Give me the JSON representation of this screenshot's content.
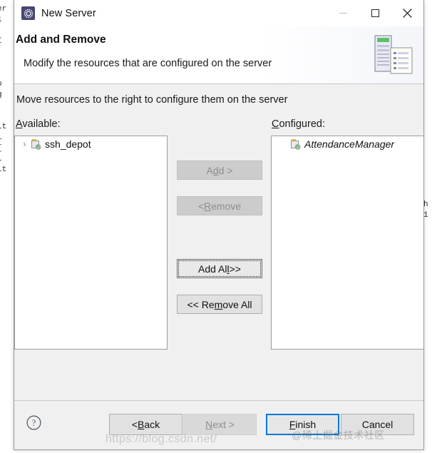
{
  "window": {
    "title": "New Server",
    "icon": "server-gear-icon",
    "controls": {
      "minimize": "minimize-icon",
      "maximize": "maximize-icon",
      "close": "close-icon"
    }
  },
  "header": {
    "title": "Add and Remove",
    "description": "Modify the resources that are configured on the server",
    "artwork": "server-and-document-icon"
  },
  "body": {
    "instruction": "Move resources to the right to configure them on the server",
    "available": {
      "label_prefix": "",
      "label_mnemonic": "A",
      "label_suffix": "vailable:",
      "items": [
        {
          "name": "ssh_depot",
          "icon": "project-icon",
          "expandable": true,
          "expander": "›",
          "italic": false
        }
      ]
    },
    "configured": {
      "label_prefix": "",
      "label_mnemonic": "C",
      "label_suffix": "onfigured:",
      "items": [
        {
          "name": "AttendanceManager",
          "icon": "project-icon",
          "expandable": false,
          "expander": "",
          "italic": true
        }
      ]
    },
    "transfer_buttons": [
      {
        "prefix": "A",
        "mnemonic": "d",
        "suffix": "d >",
        "state": "disabled",
        "key": "add"
      },
      {
        "prefix": "< ",
        "mnemonic": "R",
        "suffix": "emove",
        "state": "disabled",
        "key": "remove"
      },
      {
        "prefix": "Add Al",
        "mnemonic": "l",
        "suffix": " >>",
        "state": "focused",
        "key": "add-all"
      },
      {
        "prefix": "<< Re",
        "mnemonic": "m",
        "suffix": "ove All",
        "state": "enabled",
        "key": "remove-all"
      }
    ]
  },
  "footer": {
    "help": "help-icon",
    "buttons": [
      {
        "prefix": "< ",
        "mnemonic": "B",
        "suffix": "ack",
        "state": "enabled",
        "key": "back"
      },
      {
        "prefix": "",
        "mnemonic": "N",
        "suffix": "ext >",
        "state": "disabled",
        "key": "next"
      },
      {
        "prefix": "",
        "mnemonic": "F",
        "suffix": "inish",
        "state": "default",
        "key": "finish"
      },
      {
        "prefix": "Cancel",
        "mnemonic": "",
        "suffix": "",
        "state": "enabled",
        "key": "cancel"
      }
    ]
  },
  "watermarks": {
    "url": "https://blog.csdn.net/",
    "community": "@稀土掘金技术社区"
  },
  "background_code": {
    "left": "er\n1\n\nI\n\n\n\np\ng\n\n\nlt\ni\n{\ni\nlt\n\n\n|",
    "right": "h\n1"
  },
  "colors": {
    "accent": "#0078d7",
    "dialog_bg": "#f0f0f0",
    "titlebar_bg": "#ffffff",
    "title_icon_bg": "#464673",
    "border": "#9a9a9a",
    "disabled_text": "#8d8d8d"
  }
}
